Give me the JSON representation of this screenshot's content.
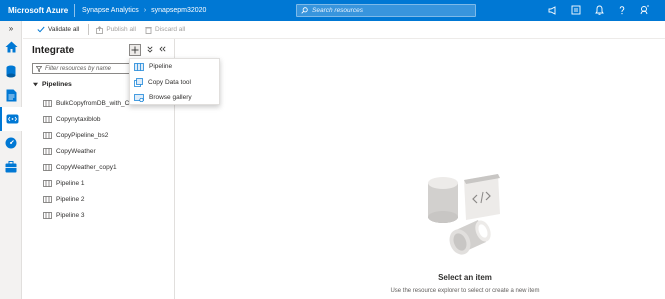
{
  "header": {
    "brand": "Microsoft Azure",
    "breadcrumbs": [
      "Synapse Analytics",
      "synapsepm32020"
    ],
    "breadcrumb_separator": "›",
    "search_placeholder": "Search resources",
    "icons": [
      "announcement-icon",
      "switch-directory-icon",
      "notifications-icon",
      "help-icon",
      "feedback-icon"
    ]
  },
  "rail": {
    "icons": [
      "home-icon",
      "data-icon",
      "develop-icon",
      "integrate-icon",
      "monitor-icon",
      "manage-icon"
    ],
    "expand_glyph": "»"
  },
  "commandbar": {
    "validate_all": "Validate all",
    "publish_all": "Publish all",
    "discard_all": "Discard all"
  },
  "panel": {
    "title": "Integrate",
    "filter_placeholder": "Filter resources by name",
    "section_label": "Pipelines",
    "items": [
      "BulkCopyfromDB_with_Co",
      "Copynytaxiblob",
      "CopyPipeline_bs2",
      "CopyWeather",
      "CopyWeather_copy1",
      "Pipeline 1",
      "Pipeline 2",
      "Pipeline 3"
    ]
  },
  "menu": {
    "items": [
      "Pipeline",
      "Copy Data tool",
      "Browse gallery"
    ]
  },
  "empty_state": {
    "title": "Select an item",
    "subtitle": "Use the resource explorer to select or create a new item"
  },
  "colors": {
    "azure_blue": "#0078d4",
    "rail_bg": "#f3f2f1",
    "icon_blue": "#0078d4"
  }
}
